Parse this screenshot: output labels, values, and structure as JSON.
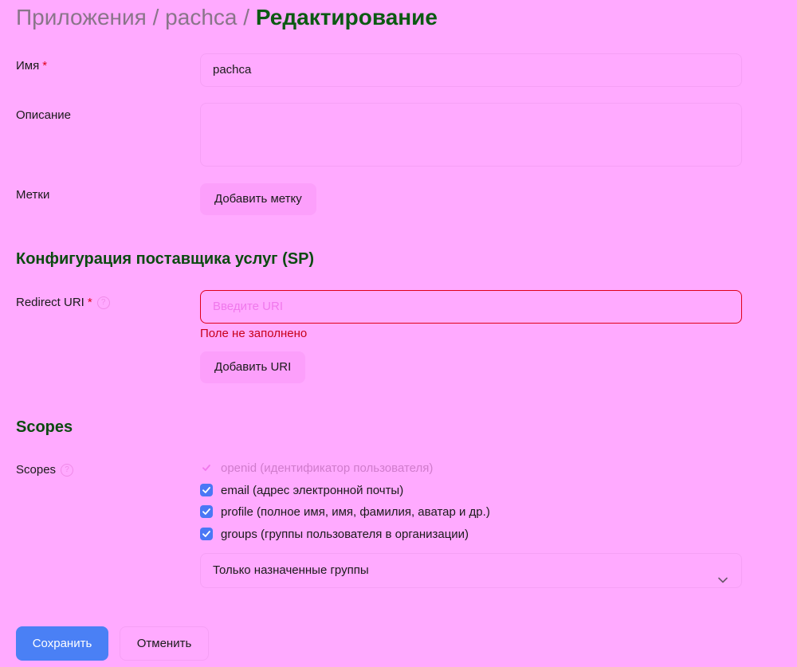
{
  "breadcrumb": {
    "part1": "Приложения",
    "sep": "/",
    "part2": "pachca",
    "current": "Редактирование"
  },
  "form": {
    "name_label": "Имя",
    "required_mark": "*",
    "name_value": "pachca",
    "description_label": "Описание",
    "description_value": "",
    "tags_label": "Метки",
    "add_tag_button": "Добавить метку"
  },
  "sp_section": {
    "title": "Конфигурация поставщика услуг (SP)",
    "redirect_label": "Redirect URI",
    "redirect_placeholder": "Введите URI",
    "error_text": "Поле не заполнено",
    "add_uri_button": "Добавить URI",
    "help_icon": "?"
  },
  "scopes_section": {
    "title": "Scopes",
    "label": "Scopes",
    "items": [
      {
        "label": "openid (идентификатор пользователя)",
        "checked": true,
        "disabled": true
      },
      {
        "label": "email (адрес электронной почты)",
        "checked": true,
        "disabled": false
      },
      {
        "label": "profile (полное имя, имя, фамилия, аватар и др.)",
        "checked": true,
        "disabled": false
      },
      {
        "label": "groups (группы пользователя в организации)",
        "checked": true,
        "disabled": false
      }
    ],
    "groups_select_value": "Только назначенные группы"
  },
  "actions": {
    "save": "Сохранить",
    "cancel": "Отменить"
  },
  "colors": {
    "background": "#ffaaff",
    "accent": "#4a80f5",
    "error": "#e0001a",
    "heading": "#0b5a12"
  }
}
